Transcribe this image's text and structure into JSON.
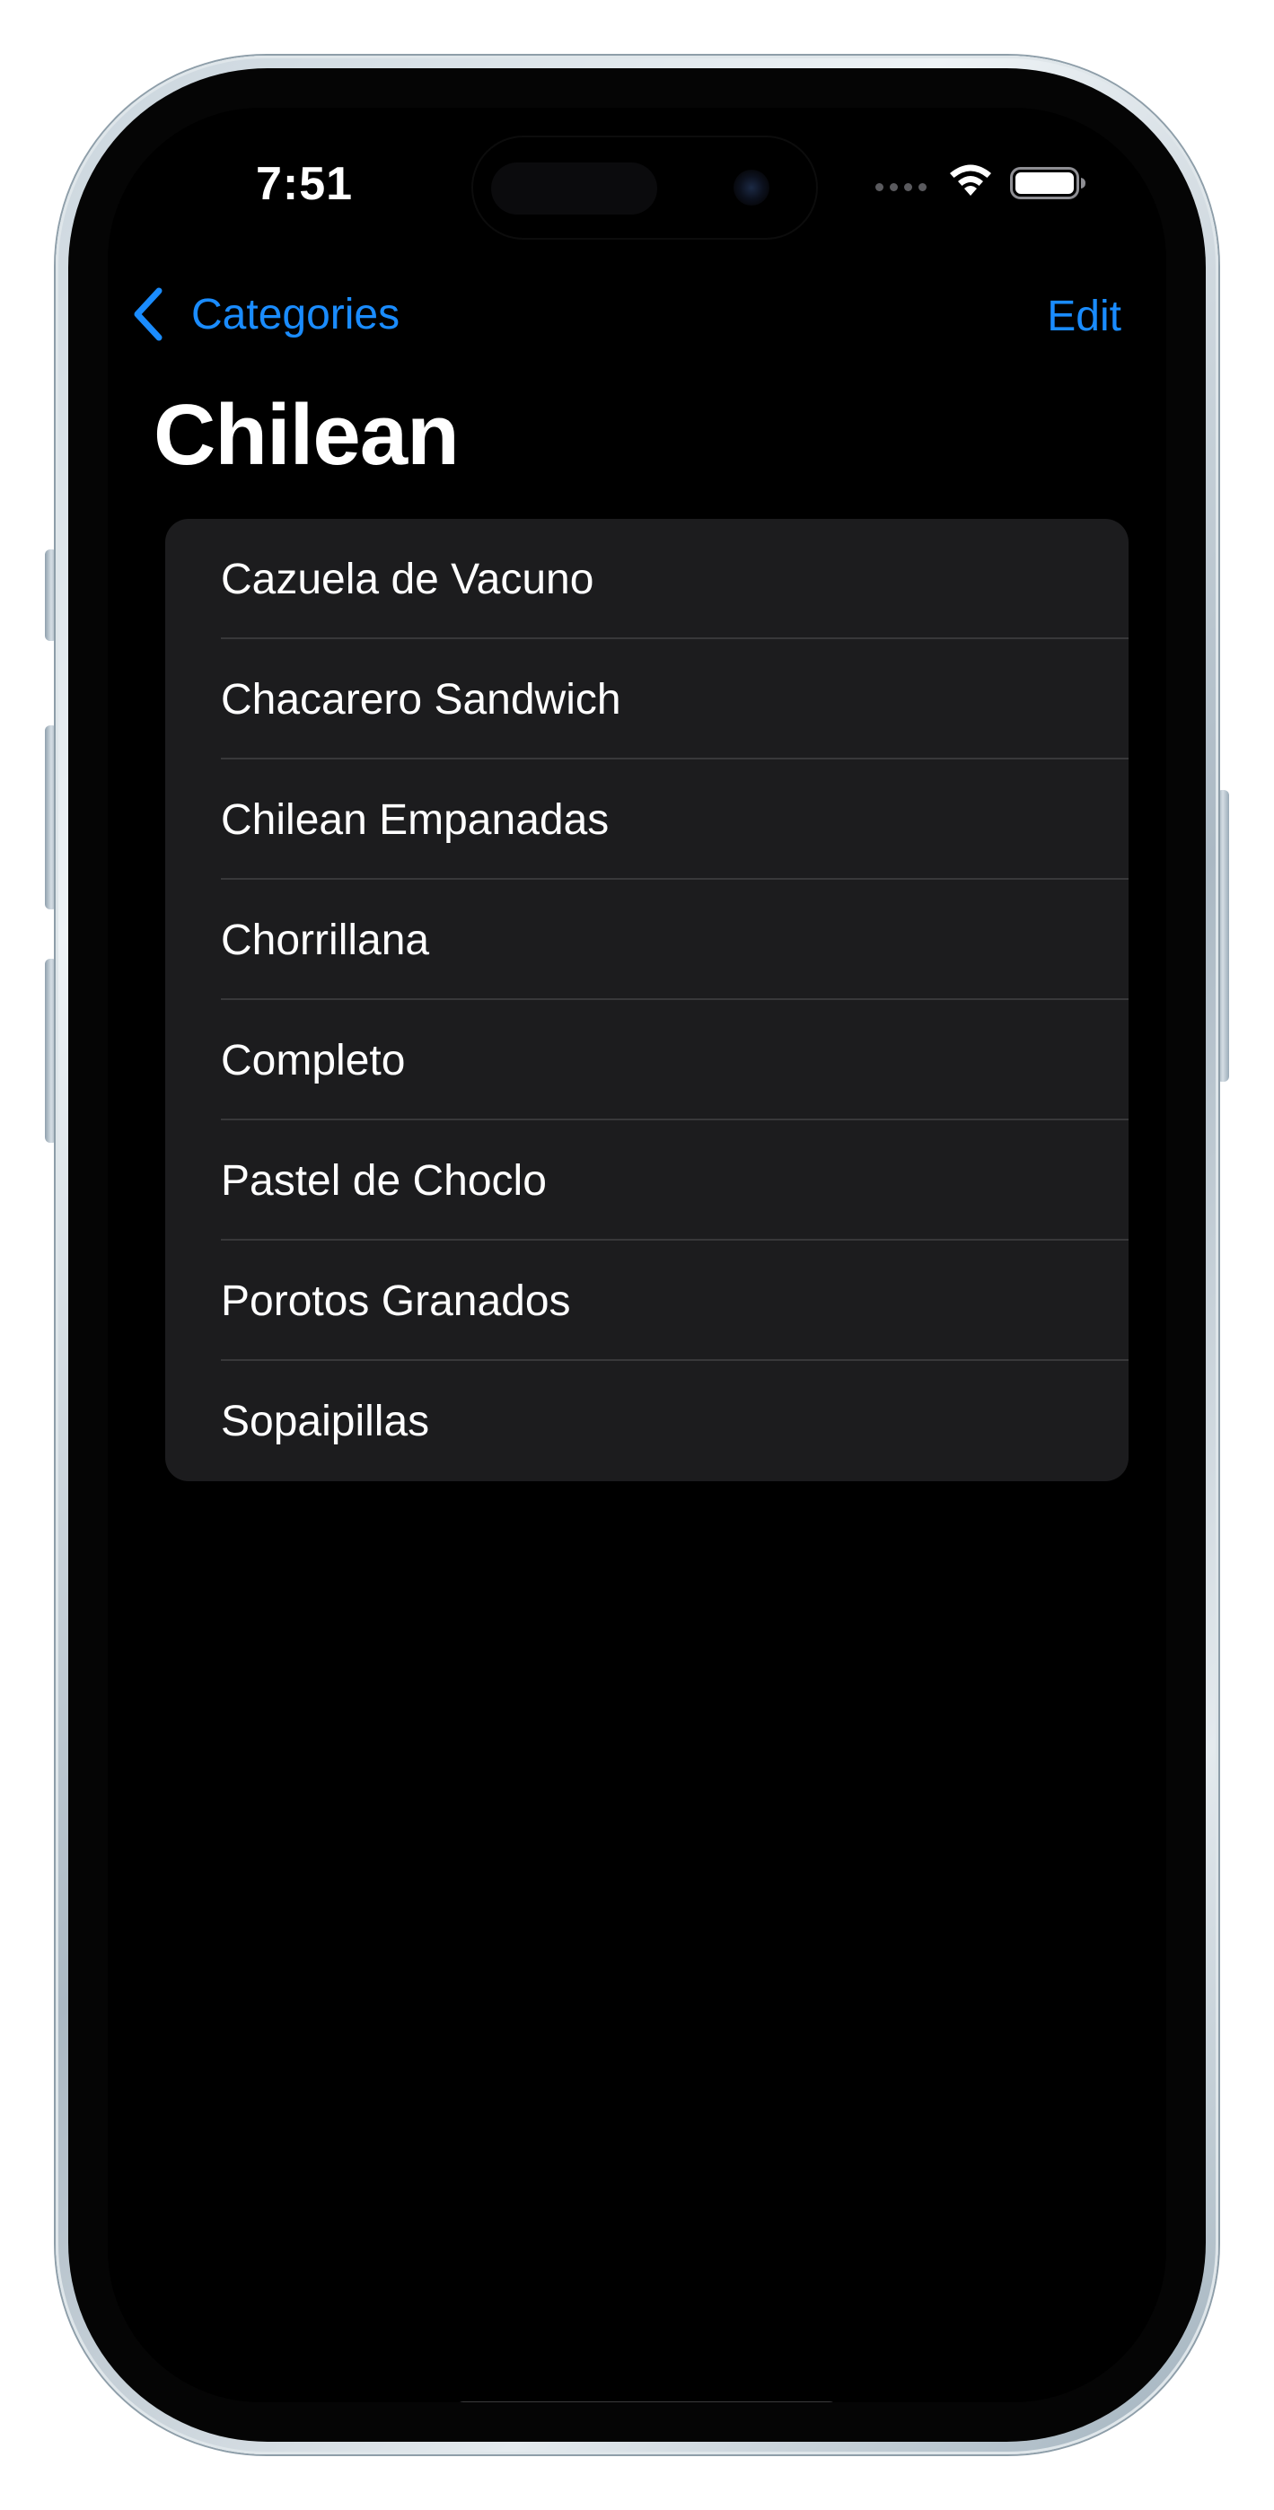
{
  "status_bar": {
    "time": "7:51",
    "icons": [
      "cellular-signal-icon",
      "wifi-icon",
      "battery-icon"
    ]
  },
  "nav": {
    "back_label": "Categories",
    "back_icon": "chevron-left-icon",
    "edit_label": "Edit"
  },
  "page": {
    "title": "Chilean"
  },
  "items": [
    "Cazuela de Vacuno",
    "Chacarero Sandwich",
    "Chilean Empanadas",
    "Chorrillana",
    "Completo",
    "Pastel de Choclo",
    "Porotos Granados",
    "Sopaipillas"
  ],
  "colors": {
    "accent": "#1a8cff",
    "background": "#000000",
    "list_background": "#1c1c1e",
    "separator": "#38383a",
    "text": "#ffffff"
  }
}
